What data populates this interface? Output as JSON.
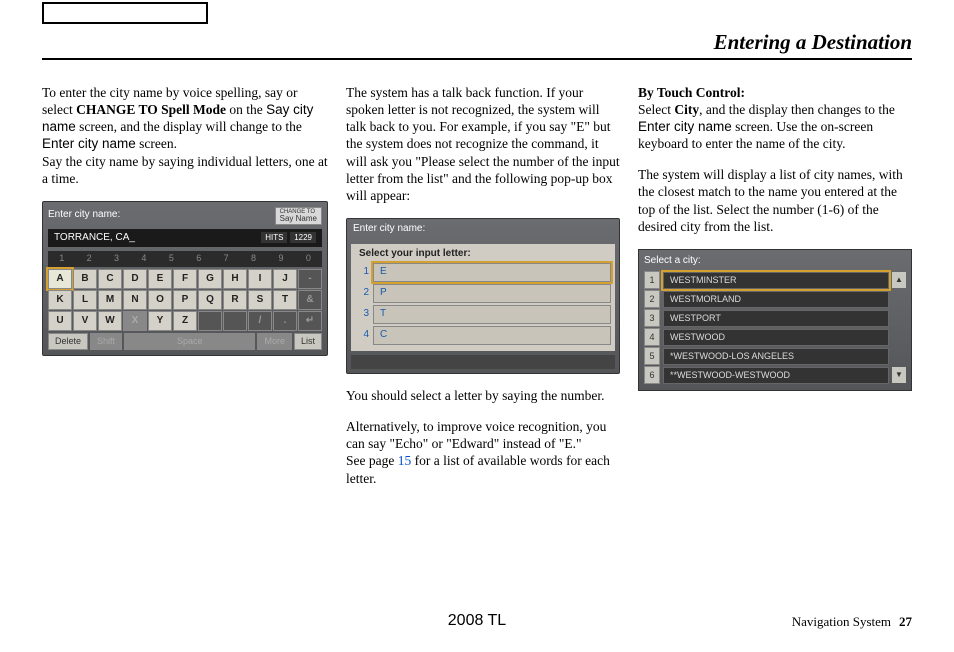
{
  "header": {
    "title": "Entering a Destination"
  },
  "col1": {
    "p1a": "To enter the city name by voice spelling, say or select ",
    "p1b": "CHANGE TO Spell Mode",
    "p1c": " on the ",
    "p1d": "Say city name",
    "p1e": " screen, and the display will change to the ",
    "p1f": "Enter city name",
    "p1g": " screen.",
    "p2": "Say the city name by saying individual letters, one at a time.",
    "scr": {
      "title": "Enter city name:",
      "button_top": "CHANGE TO",
      "button_label": "Say Name",
      "input": "TORRANCE, CA_",
      "hits_label": "HITS",
      "hits_value": "1229",
      "nums": [
        "1",
        "2",
        "3",
        "4",
        "5",
        "6",
        "7",
        "8",
        "9",
        "0"
      ],
      "row1": [
        "A",
        "B",
        "C",
        "D",
        "E",
        "F",
        "G",
        "H",
        "I",
        "J"
      ],
      "row2": [
        "K",
        "L",
        "M",
        "N",
        "O",
        "P",
        "Q",
        "R",
        "S",
        "T"
      ],
      "row3": [
        "U",
        "V",
        "W",
        "",
        "Y",
        "Z"
      ],
      "delete": "Delete",
      "shift": "Shift",
      "space": "Space",
      "more": "More",
      "list": "List"
    }
  },
  "col2": {
    "p1": "The system has a talk back function. If your spoken letter is not recognized, the system will talk back to you. For example, if you say \"E\" but the system does not recognize the command, it will ask you \"Please select the number of the input letter from the list\" and the following pop-up box will appear:",
    "scr": {
      "header": "Enter city name:",
      "popup_title": "Select your input letter:",
      "items": [
        {
          "n": "1",
          "v": "E"
        },
        {
          "n": "2",
          "v": "P"
        },
        {
          "n": "3",
          "v": "T"
        },
        {
          "n": "4",
          "v": "C"
        }
      ]
    },
    "p2": "You should select a letter by saying the number.",
    "p3a": "Alternatively, to improve voice recognition, you can say \"Echo\" or \"Edward\" instead of \"E.\"",
    "p3b": "See page ",
    "p3link": "15",
    "p3c": " for a list of available words for each letter."
  },
  "col3": {
    "h": "By Touch Control:",
    "p1a": "Select ",
    "p1b": "City",
    "p1c": ", and the display then changes to the ",
    "p1d": "Enter city name",
    "p1e": " screen. Use the on-screen keyboard to enter the name of the city.",
    "p2": "The system will display a list of city names, with the closest match to the name you entered at the top of the list. Select the number (1-6) of the desired city from the list.",
    "scr": {
      "title": "Select a city:",
      "items": [
        {
          "n": "1",
          "v": "WESTMINSTER"
        },
        {
          "n": "2",
          "v": "WESTMORLAND"
        },
        {
          "n": "3",
          "v": "WESTPORT"
        },
        {
          "n": "4",
          "v": "WESTWOOD"
        },
        {
          "n": "5",
          "v": "*WESTWOOD-LOS ANGELES"
        },
        {
          "n": "6",
          "v": "**WESTWOOD-WESTWOOD"
        }
      ]
    }
  },
  "footer": {
    "center": "2008 TL",
    "right_label": "Navigation System",
    "page": "27"
  }
}
